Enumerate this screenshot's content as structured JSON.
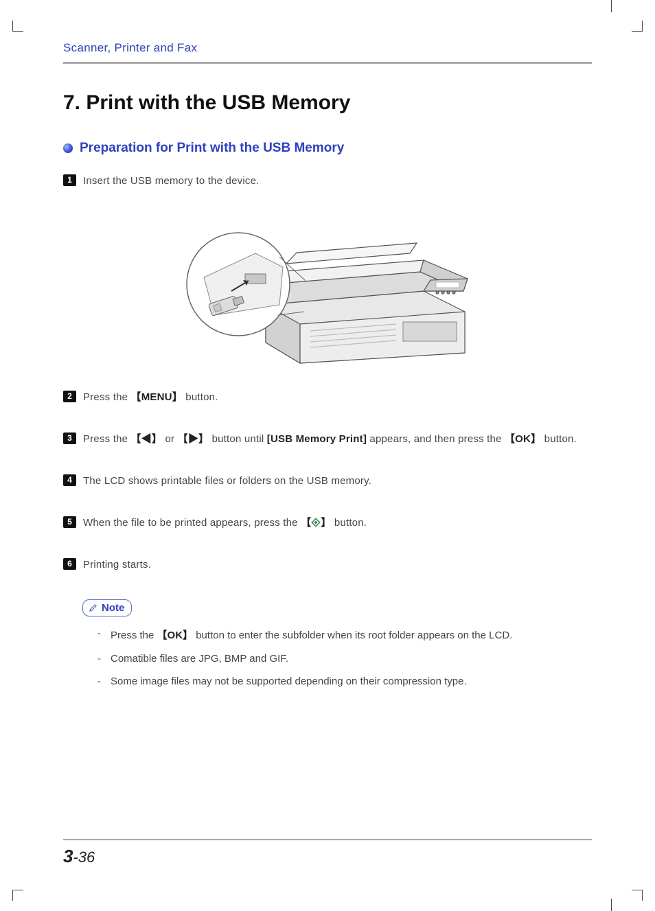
{
  "header": "Scanner, Printer and Fax",
  "title": "7. Print with the USB Memory",
  "subsection": "Preparation for Print with the USB Memory",
  "steps": {
    "s1": "Insert the USB memory to the device.",
    "s2_a": "Press the ",
    "s2_b": "【MENU】",
    "s2_c": " button.",
    "s3_a": "Press the ",
    "s3_b": "【◀】",
    "s3_c": " or ",
    "s3_d": "【▶】",
    "s3_e": " button until ",
    "s3_f": "[USB Memory Print]",
    "s3_g": " appears, and then press the ",
    "s3_h": "【OK】",
    "s3_i": " button.",
    "s4": "The LCD shows printable files or folders on the USB memory.",
    "s5_a": "When the file to be printed appears, press the ",
    "s5_b": "【",
    "s5_c": "】",
    "s5_d": " button.",
    "s6": "Printing starts."
  },
  "note_label": "Note",
  "notes": {
    "n1_a": "Press the ",
    "n1_b": "【OK】",
    "n1_c": " button to enter the subfolder when its root folder appears on the LCD.",
    "n2": "Comatible files are JPG, BMP and GIF.",
    "n3": "Some image files may not be supported depending on their compression type."
  },
  "page_chapter": "3",
  "page_sep": "-",
  "page_num": "36"
}
